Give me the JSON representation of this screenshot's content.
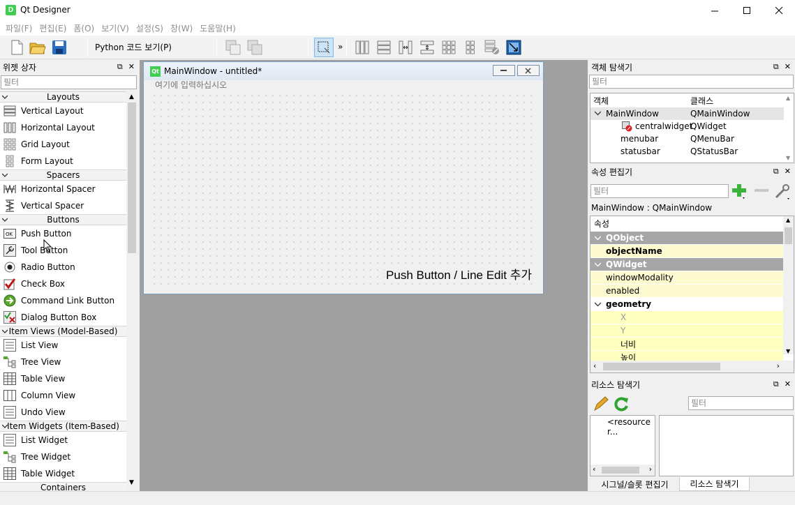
{
  "window": {
    "title": "Qt Designer",
    "icon_letter": "D"
  },
  "menubar": [
    "파일(F)",
    "편집(E)",
    "폼(O)",
    "보기(V)",
    "설정(S)",
    "창(W)",
    "도움말(H)"
  ],
  "toolbar": {
    "python_label": "Python 코드 보기(P)",
    "overflow": "»"
  },
  "widget_box": {
    "title": "위젯 상자",
    "filter_placeholder": "필터",
    "categories": [
      {
        "name": "Layouts",
        "items": [
          "Vertical Layout",
          "Horizontal Layout",
          "Grid Layout",
          "Form Layout"
        ]
      },
      {
        "name": "Spacers",
        "items": [
          "Horizontal Spacer",
          "Vertical Spacer"
        ]
      },
      {
        "name": "Buttons",
        "items": [
          "Push Button",
          "Tool Button",
          "Radio Button",
          "Check Box",
          "Command Link Button",
          "Dialog Button Box"
        ]
      },
      {
        "name": "Item Views (Model-Based)",
        "items": [
          "List View",
          "Tree View",
          "Table View",
          "Column View",
          "Undo View"
        ]
      },
      {
        "name": "Item Widgets (Item-Based)",
        "items": [
          "List Widget",
          "Tree Widget",
          "Table Widget"
        ]
      }
    ],
    "next_category_partial": "Containers"
  },
  "form_window": {
    "title": "MainWindow - untitled*",
    "icon_text": "Qt",
    "menu_placeholder": "여기에 입력하십시오",
    "caption": "Push Button / Line Edit 추가"
  },
  "object_inspector": {
    "title": "객체 탐색기",
    "filter_placeholder": "필터",
    "col_object": "객체",
    "col_class": "클래스",
    "rows": [
      {
        "object": "MainWindow",
        "class": "QMainWindow"
      },
      {
        "object": "centralwidget",
        "class": "QWidget"
      },
      {
        "object": "menubar",
        "class": "QMenuBar"
      },
      {
        "object": "statusbar",
        "class": "QStatusBar"
      }
    ]
  },
  "property_editor": {
    "title": "속성 편집기",
    "filter_placeholder": "필터",
    "context": "MainWindow : QMainWindow",
    "header": "속성",
    "rows": [
      {
        "label": "QObject",
        "kind": "group"
      },
      {
        "label": "objectName",
        "kind": "bold"
      },
      {
        "label": "QWidget",
        "kind": "group"
      },
      {
        "label": "windowModality",
        "kind": "prop"
      },
      {
        "label": "enabled",
        "kind": "prop"
      },
      {
        "label": "geometry",
        "kind": "expand"
      },
      {
        "label": "X",
        "kind": "sub-muted"
      },
      {
        "label": "Y",
        "kind": "sub-muted"
      },
      {
        "label": "너비",
        "kind": "sub"
      },
      {
        "label": "높이",
        "kind": "sub"
      }
    ]
  },
  "resource_browser": {
    "title": "리소스 탐색기",
    "filter_placeholder": "필터",
    "root": "<resource r..."
  },
  "bottom_tabs": [
    "시그널/슬롯 편집기",
    "리소스 탐색기"
  ],
  "colors": {
    "group_header": "#a6a6a6",
    "property_yellow": "#fffbd0",
    "mdi_background": "#a0a0a0",
    "selected_row": "#e5e5e5"
  }
}
